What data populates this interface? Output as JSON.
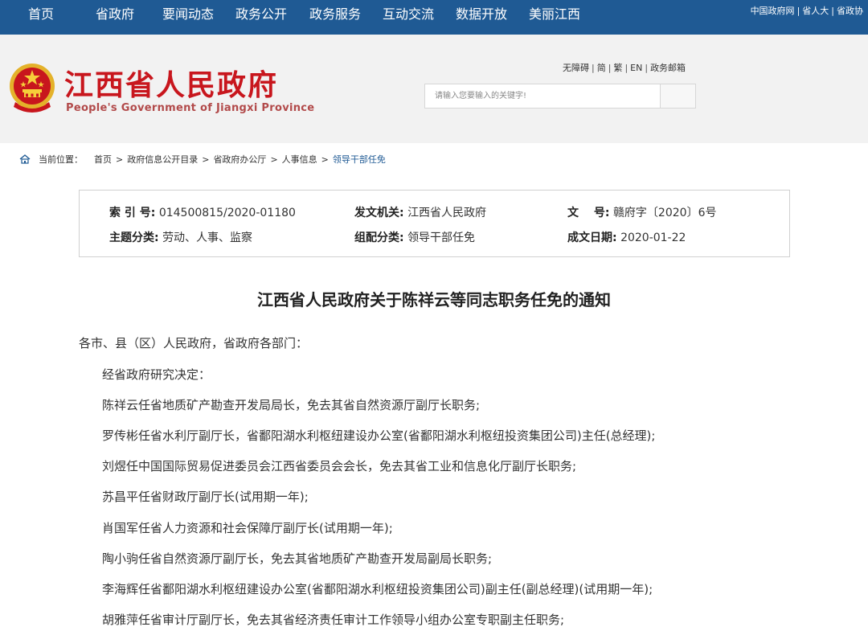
{
  "topnav": {
    "items": [
      "首页",
      "省政府",
      "要闻动态",
      "政务公开",
      "政务服务",
      "互动交流",
      "数据开放",
      "美丽江西"
    ],
    "links": [
      "中国政府网",
      "省人大",
      "省政协"
    ]
  },
  "header": {
    "title": "江西省人民政府",
    "subtitle": "People's Government of Jiangxi Province",
    "util_links": [
      "无障碍",
      "简",
      "繁",
      "EN",
      "政务邮箱"
    ],
    "search_placeholder": "请输入您要输入的关键字!"
  },
  "breadcrumb": {
    "label": "当前位置：",
    "items": [
      "首页",
      "政府信息公开目录",
      "省政府办公厅",
      "人事信息",
      "领导干部任免"
    ]
  },
  "info": {
    "index_label": "索 引 号:",
    "index_value": "014500815/2020-01180",
    "issuer_label": "发文机关:",
    "issuer_value": "江西省人民政府",
    "doc_label": "文　 号:",
    "doc_value": "赣府字〔2020〕6号",
    "topic_label": "主题分类:",
    "topic_value": "劳动、人事、监察",
    "category_label": "组配分类:",
    "category_value": "领导干部任免",
    "date_label": "成文日期:",
    "date_value": "2020-01-22"
  },
  "article": {
    "title": "江西省人民政府关于陈祥云等同志职务任免的通知",
    "salutation": "各市、县（区）人民政府，省政府各部门：",
    "paragraphs": [
      "经省政府研究决定：",
      "陈祥云任省地质矿产勘查开发局局长，免去其省自然资源厅副厅长职务;",
      "罗传彬任省水利厅副厅长，省鄱阳湖水利枢纽建设办公室(省鄱阳湖水利枢纽投资集团公司)主任(总经理);",
      "刘煜任中国国际贸易促进委员会江西省委员会会长，免去其省工业和信息化厅副厅长职务;",
      "苏昌平任省财政厅副厅长(试用期一年);",
      "肖国军任省人力资源和社会保障厅副厅长(试用期一年);",
      "陶小驹任省自然资源厅副厅长，免去其省地质矿产勘查开发局副局长职务;",
      "李海辉任省鄱阳湖水利枢纽建设办公室(省鄱阳湖水利枢纽投资集团公司)副主任(副总经理)(试用期一年);",
      "胡雅萍任省审计厅副厅长，免去其省经济责任审计工作领导小组办公室专职副主任职务;"
    ]
  },
  "colors": {
    "nav_bg": "#1f5a94",
    "title_red": "#c8161d",
    "header_bg": "#f2f2f2"
  }
}
